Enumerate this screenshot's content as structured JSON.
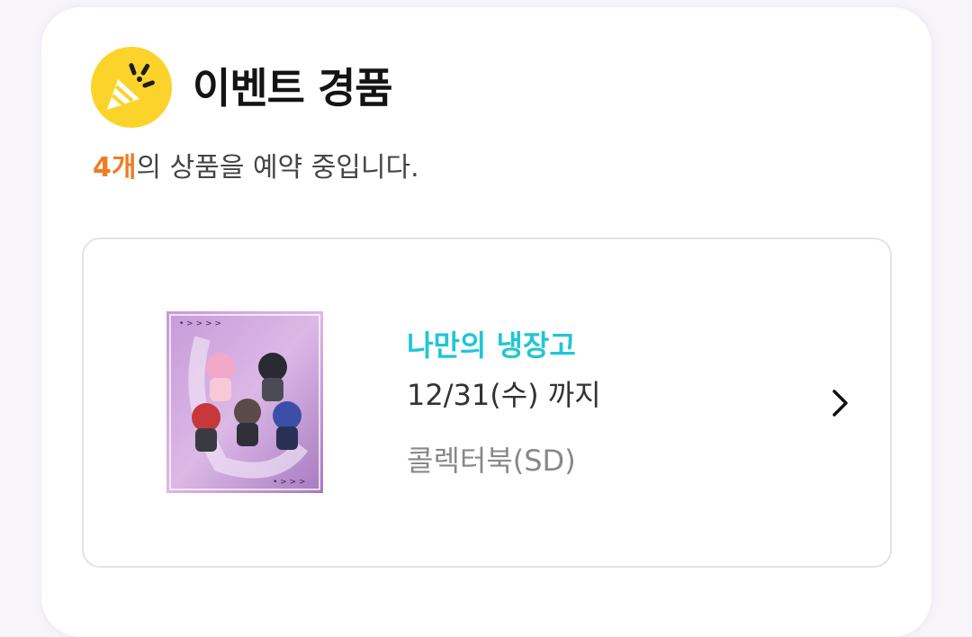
{
  "section": {
    "title": "이벤트 경품",
    "icon": "party-popper-icon",
    "count_label": "4개",
    "count_suffix": "의 상품을 예약 중입니다."
  },
  "colors": {
    "accent_orange": "#ef7c21",
    "product_name": "#20c6d4",
    "icon_bg": "#fcd32b"
  },
  "product": {
    "name": "나만의 냉장고",
    "date": "12/31(수) 까지",
    "type": "콜렉터북(SD)",
    "thumbnail": "collector-book-cover-image",
    "action_icon": "chevron-right-icon"
  }
}
